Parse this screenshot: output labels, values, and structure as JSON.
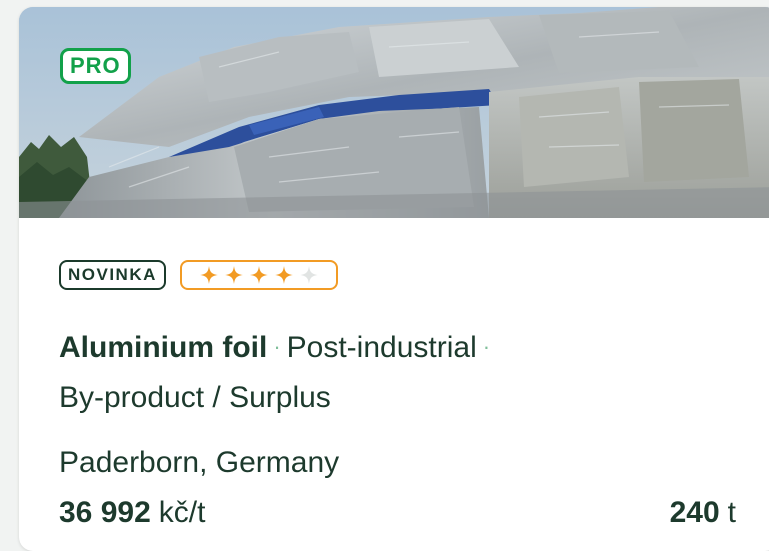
{
  "badges": {
    "pro": "PRO",
    "new": "NOVINKA"
  },
  "rating": {
    "value": 4,
    "max": 5,
    "filled_color": "#f29b24",
    "empty_color": "#e1e4e3"
  },
  "listing": {
    "material": "Aluminium foil",
    "source": "Post-industrial",
    "separator": "·",
    "category": "By-product / Surplus",
    "location": "Paderborn, Germany",
    "price_value": "36 992",
    "price_unit": "kč/t",
    "quantity_value": "240",
    "quantity_unit": "t"
  },
  "colors": {
    "brand_green": "#12a14a",
    "text_dark": "#1d3a2d",
    "rating_orange": "#f29b24"
  }
}
